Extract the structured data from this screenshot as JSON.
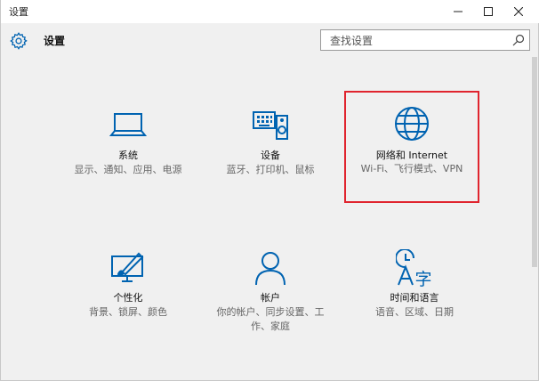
{
  "window": {
    "title": "设置",
    "controls": {
      "minimize": "—",
      "maximize": "☐",
      "close": "✕"
    }
  },
  "header": {
    "title": "设置",
    "search": {
      "placeholder": "查找设置",
      "value": ""
    }
  },
  "colors": {
    "accent": "#0063b1",
    "selection": "#e0242e"
  },
  "tiles": [
    {
      "name": "系统",
      "desc": "显示、通知、应用、电源",
      "icon": "laptop-icon"
    },
    {
      "name": "设备",
      "desc": "蓝牙、打印机、鼠标",
      "icon": "devices-icon"
    },
    {
      "name": "网络和 Internet",
      "desc": "Wi-Fi、飞行模式、VPN",
      "icon": "globe-icon",
      "selected": true
    },
    {
      "name": "个性化",
      "desc": "背景、锁屏、颜色",
      "icon": "personalization-icon"
    },
    {
      "name": "帐户",
      "desc": "你的帐户、同步设置、工作、家庭",
      "icon": "account-icon"
    },
    {
      "name": "时间和语言",
      "desc": "语音、区域、日期",
      "icon": "time-language-icon"
    }
  ]
}
